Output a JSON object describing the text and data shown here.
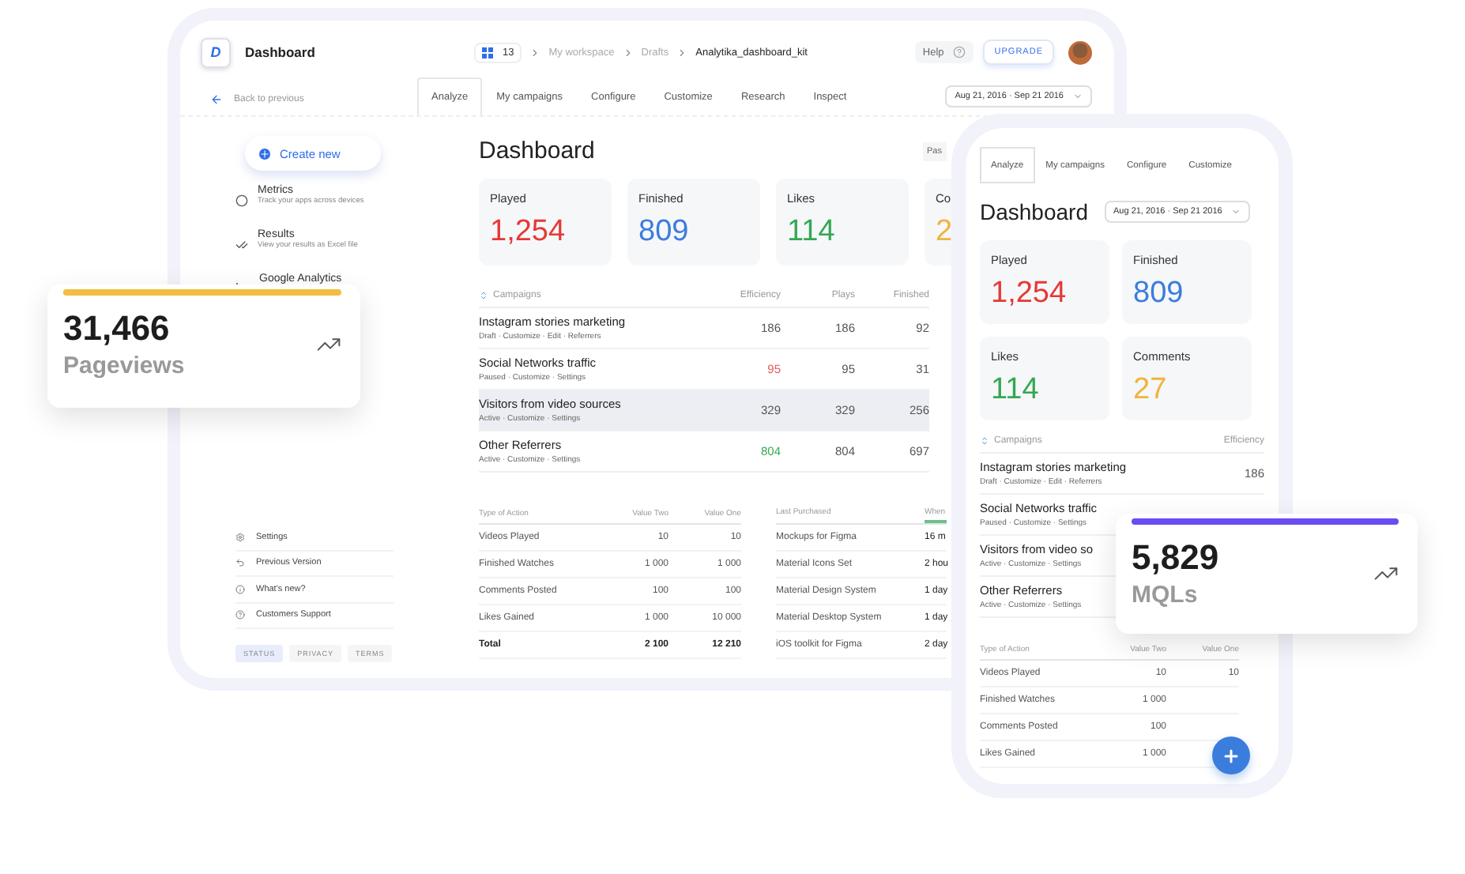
{
  "desktop": {
    "app_title": "Dashboard",
    "logo": "D",
    "breadcrumb": {
      "count": "13",
      "items": [
        "My workspace",
        "Drafts",
        "Analytika_dashboard_kit"
      ]
    },
    "help": "Help",
    "upgrade": "UPGRADE",
    "back": "Back to previous",
    "tabs": [
      {
        "label": "Analyze",
        "selected": true
      },
      {
        "label": "My campaigns",
        "selected": false
      },
      {
        "label": "Configure",
        "selected": false
      },
      {
        "label": "Customize",
        "selected": false
      },
      {
        "label": "Research",
        "selected": false
      },
      {
        "label": "Inspect",
        "selected": false
      }
    ],
    "date_range": "Aug 21, 2016 · Sep 21 2016",
    "sidebar": {
      "create": "Create new",
      "items": [
        {
          "title": "Metrics",
          "desc": "Track your apps across devices"
        },
        {
          "title": "Results",
          "desc": "View your results as Excel file"
        },
        {
          "title": "Google Analytics"
        }
      ],
      "links": [
        "Settings",
        "Previous Version",
        "What's new?",
        "Customers Support"
      ],
      "chips": [
        {
          "label": "STATUS",
          "selected": true
        },
        {
          "label": "PRIVACY",
          "selected": false
        },
        {
          "label": "TERMS",
          "selected": false
        }
      ]
    },
    "main": {
      "title": "Dashboard",
      "chip": "Pas",
      "stats": [
        {
          "label": "Played",
          "value": "1,254",
          "color": "#e53935"
        },
        {
          "label": "Finished",
          "value": "809",
          "color": "#3b7ddd"
        },
        {
          "label": "Likes",
          "value": "114",
          "color": "#34a853"
        },
        {
          "label": "Co",
          "value": "2",
          "color": "#f0b43c"
        }
      ],
      "campaigns": {
        "columns": [
          "Campaigns",
          "Efficiency",
          "Plays",
          "Finished"
        ],
        "rows": [
          {
            "name": "Instagram stories marketing",
            "actions": "Draft · Customize · Edit · Referrers",
            "efficiency": "186",
            "plays": "186",
            "finished": "92",
            "color": "#555555",
            "selected": false
          },
          {
            "name": "Social Networks traffic",
            "actions": "Paused · Customize · Settings",
            "efficiency": "95",
            "plays": "95",
            "finished": "31",
            "color": "#e55a5a",
            "selected": false
          },
          {
            "name": "Visitors from video sources",
            "actions": "Active · Customize · Settings",
            "efficiency": "329",
            "plays": "329",
            "finished": "256",
            "color": "#555555",
            "selected": true
          },
          {
            "name": "Other Referrers",
            "actions": "Active · Customize · Settings",
            "efficiency": "804",
            "plays": "804",
            "finished": "697",
            "color": "#34a853",
            "selected": false
          }
        ]
      },
      "actions": {
        "columns": [
          "Type of Action",
          "Value Two",
          "Value One"
        ],
        "rows": [
          {
            "kind": "row",
            "label": "Videos Played",
            "value_two": "10",
            "value_one": "10"
          },
          {
            "kind": "row",
            "label": "Finished Watches",
            "value_two": "1 000",
            "value_one": "1 000"
          },
          {
            "kind": "row",
            "label": "Comments Posted",
            "value_two": "100",
            "value_one": "100"
          },
          {
            "kind": "row",
            "label": "Likes Gained",
            "value_two": "1 000",
            "value_one": "10 000"
          },
          {
            "kind": "total",
            "label": "Total",
            "value_two": "2 100",
            "value_one": "12 210"
          }
        ]
      },
      "purchases": {
        "columns": [
          {
            "label": "Last Purchased",
            "sorted": false
          },
          {
            "label": "When",
            "sorted": true
          }
        ],
        "rows": [
          {
            "item": "Mockups for Figma",
            "when": "16 m"
          },
          {
            "item": "Material Icons Set",
            "when": "2 hou"
          },
          {
            "item": "Material Design System",
            "when": "1 day"
          },
          {
            "item": "Material Desktop System",
            "when": "1 day"
          },
          {
            "item": "iOS toolkit for Figma",
            "when": "2 day"
          }
        ]
      }
    }
  },
  "phone": {
    "tabs": [
      {
        "label": "Analyze",
        "selected": true
      },
      {
        "label": "My campaigns",
        "selected": false
      },
      {
        "label": "Configure",
        "selected": false
      },
      {
        "label": "Customize",
        "selected": false
      }
    ],
    "title": "Dashboard",
    "date_range": "Aug 21, 2016 · Sep 21 2016",
    "stats": [
      {
        "label": "Played",
        "value": "1,254",
        "color": "#e53935"
      },
      {
        "label": "Finished",
        "value": "809",
        "color": "#3b7ddd"
      },
      {
        "label": "Likes",
        "value": "114",
        "color": "#34a853"
      },
      {
        "label": "Comments",
        "value": "27",
        "color": "#f0b43c"
      }
    ],
    "campaign_columns": [
      "Campaigns",
      "Efficiency"
    ],
    "campaigns": [
      {
        "name": "Instagram stories marketing",
        "actions": "Draft · Customize · Edit · Referrers",
        "efficiency": "186"
      },
      {
        "name": "Social Networks traffic",
        "actions": "Paused · Customize · Settings"
      },
      {
        "name": "Visitors from video so",
        "actions": "Active · Customize · Settings"
      },
      {
        "name": "Other Referrers",
        "actions": "Active · Customize · Settings"
      }
    ],
    "action_columns": [
      "Type of Action",
      "Value Two",
      "Value One"
    ],
    "actions": [
      {
        "label": "Videos Played",
        "value_two": "10",
        "value_one": "10"
      },
      {
        "label": "Finished Watches",
        "value_two": "1 000"
      },
      {
        "label": "Comments Posted",
        "value_two": "100"
      },
      {
        "label": "Likes Gained",
        "value_two": "1 000"
      }
    ]
  },
  "cards": [
    {
      "value": "31,466",
      "label": "Pageviews",
      "color": "#f2bd42"
    },
    {
      "value": "5,829",
      "label": "MQLs",
      "color": "#6a4cf0"
    }
  ]
}
